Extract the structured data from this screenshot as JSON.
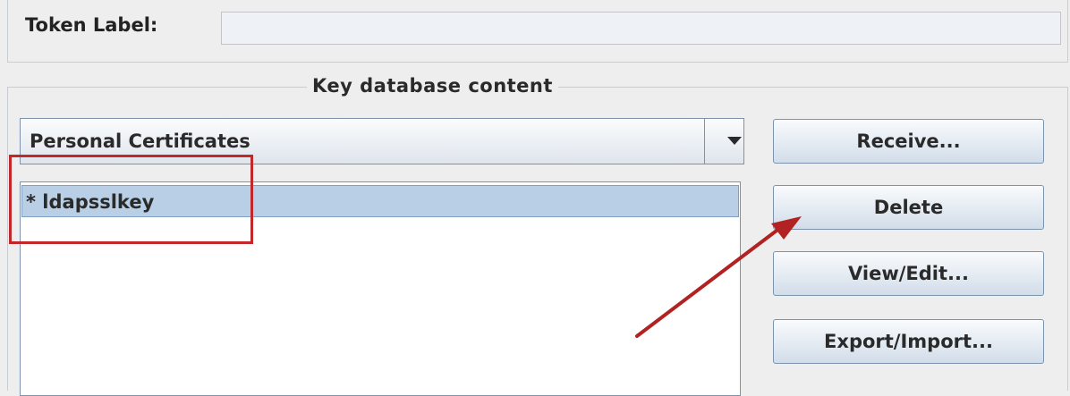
{
  "token": {
    "label": "Token Label:",
    "value": ""
  },
  "group": {
    "title": "Key database content"
  },
  "combo": {
    "selected": "Personal Certificates",
    "icon": "chevron-down-icon"
  },
  "list": {
    "items": [
      {
        "label": "* ldapsslkey",
        "selected": true
      }
    ]
  },
  "buttons": {
    "receive": "Receive...",
    "delete": "Delete",
    "view_edit": "View/Edit...",
    "export_import": "Export/Import..."
  },
  "annotation": {
    "highlight_color": "#c0282a",
    "arrow_color": "#b22222"
  }
}
